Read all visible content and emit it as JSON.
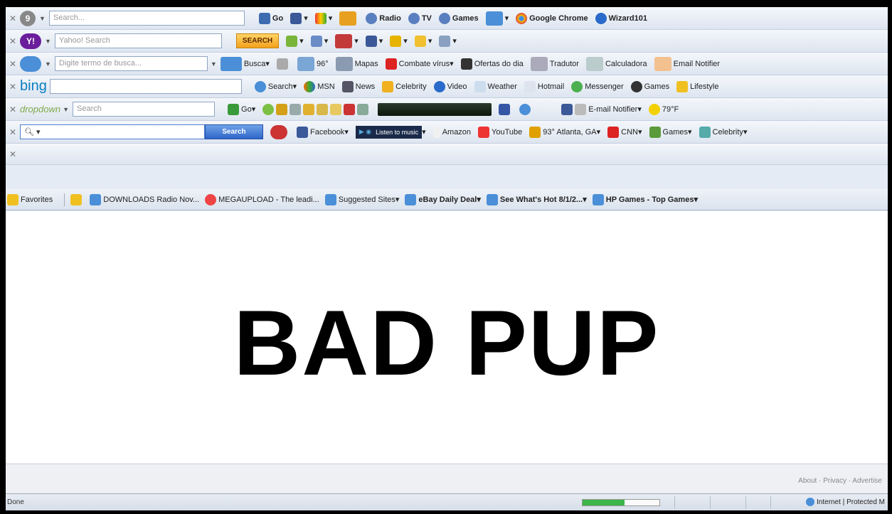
{
  "toolbars": {
    "t1": {
      "search_placeholder": "Search...",
      "items": [
        "Go",
        "Radio",
        "TV",
        "Games",
        "Google Chrome",
        "Wizard101"
      ]
    },
    "t2": {
      "search_placeholder": "Yahoo! Search",
      "search_button": "SEARCH"
    },
    "t3": {
      "search_placeholder": "Digite termo de busca...",
      "items": [
        "Busca",
        "96°",
        "Mapas",
        "Combate vírus",
        "Ofertas do dia",
        "Tradutor",
        "Calculadora",
        "Email Notifier"
      ]
    },
    "t4": {
      "logo": "bing",
      "items": [
        "Search",
        "MSN",
        "News",
        "Celebrity",
        "Video",
        "Weather",
        "Hotmail",
        "Messenger",
        "Games",
        "Lifestyle"
      ]
    },
    "t5": {
      "logo": "dropdown",
      "search_placeholder": "Search",
      "go": "Go",
      "email": "E-mail Notifier",
      "temp": "79°F"
    },
    "t6": {
      "search_button": "Search",
      "music": "Listen to music",
      "items": [
        "Facebook",
        "Amazon",
        "YouTube",
        "93° Atlanta, GA",
        "CNN",
        "Games",
        "Celebrity"
      ]
    }
  },
  "favorites": {
    "label": "Favorites",
    "items": [
      "DOWNLOADS Radio Nov...",
      "MEGAUPLOAD - The leadi...",
      "Suggested Sites",
      "eBay Daily Deal",
      "See What's Hot 8/1/2...",
      "HP Games - Top Games"
    ]
  },
  "content": {
    "headline": "BAD PUP"
  },
  "footer": {
    "links": "About · Privacy · Advertise"
  },
  "status": {
    "text": "Done",
    "progress": 0.55,
    "zone": "Internet | Protected M"
  }
}
